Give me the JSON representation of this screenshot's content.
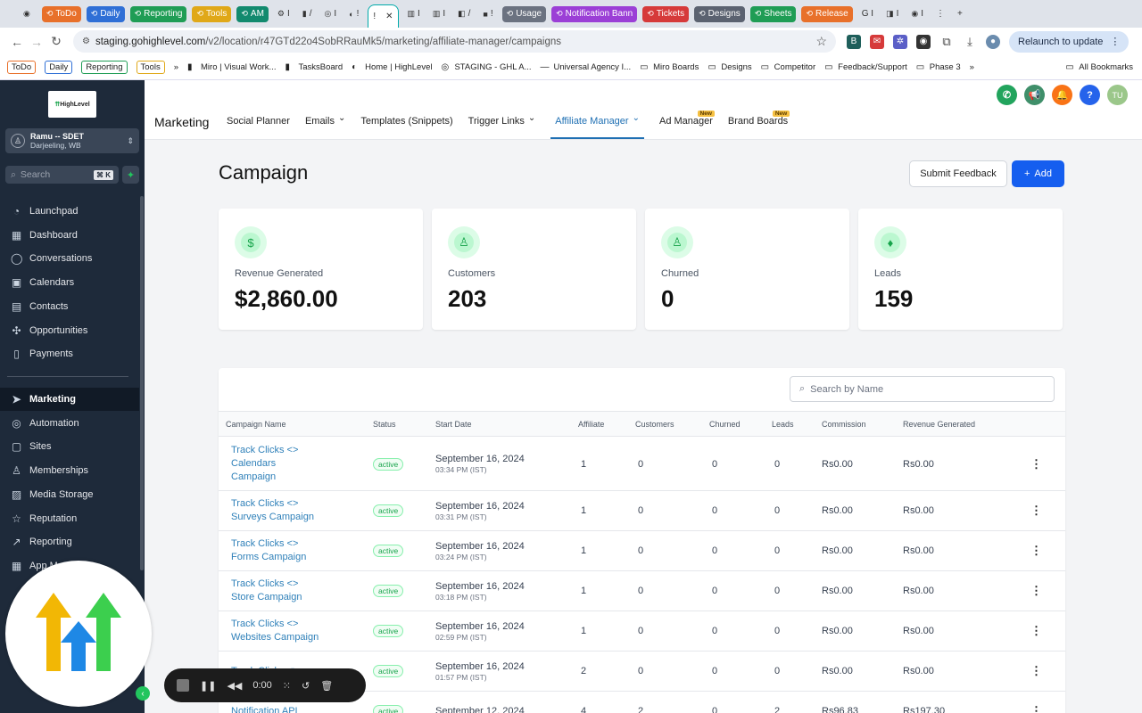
{
  "browser": {
    "tabs": [
      {
        "label": "",
        "color": "",
        "icon": "◉",
        "plain": true
      },
      {
        "label": "ToDo",
        "color": "#e8702a",
        "icon": "⟲"
      },
      {
        "label": "Daily",
        "color": "#2f6fd6",
        "icon": "⟲"
      },
      {
        "label": "Reporting",
        "color": "#1f9d55",
        "icon": "⟲"
      },
      {
        "label": "Tools",
        "color": "#e0a818",
        "icon": "⟲"
      },
      {
        "label": "AM",
        "color": "#128a6e",
        "icon": "⟲"
      },
      {
        "label": "I",
        "color": "",
        "icon": "⚙",
        "plain": true
      },
      {
        "label": "/",
        "color": "",
        "icon": "▮",
        "plain": true
      },
      {
        "label": "I",
        "color": "",
        "icon": "◎",
        "plain": true
      },
      {
        "label": "!",
        "color": "",
        "icon": "◐",
        "plain": true
      },
      {
        "label": "!",
        "color": "",
        "icon": "",
        "active": true
      },
      {
        "label": "I",
        "color": "",
        "icon": "▥",
        "plain": true
      },
      {
        "label": "I",
        "color": "",
        "icon": "▥",
        "plain": true
      },
      {
        "label": "/",
        "color": "",
        "icon": "◧",
        "plain": true
      },
      {
        "label": "!",
        "color": "",
        "icon": "■",
        "plain": true
      },
      {
        "label": "Usage",
        "color": "#6b7280",
        "icon": "⟲"
      },
      {
        "label": "Notification Bann",
        "color": "#9b3fd6",
        "icon": "⟲"
      },
      {
        "label": "Tickets",
        "color": "#d63a3a",
        "icon": "⟲"
      },
      {
        "label": "Designs",
        "color": "#5b6270",
        "icon": "⟲"
      },
      {
        "label": "Sheets",
        "color": "#1f9d55",
        "icon": "⟲"
      },
      {
        "label": "Release",
        "color": "#e8702a",
        "icon": "⟲"
      },
      {
        "label": "G I",
        "color": "",
        "icon": "",
        "plain": true
      },
      {
        "label": "I",
        "color": "",
        "icon": "◨",
        "plain": true
      },
      {
        "label": "I",
        "color": "",
        "icon": "◉",
        "plain": true
      },
      {
        "label": "⋮",
        "color": "",
        "icon": "",
        "plain": true
      },
      {
        "label": "+",
        "color": "",
        "icon": "",
        "plain": true
      }
    ],
    "url_host": "staging.gohighlevel.com",
    "url_path": "/v2/location/r47GTd22o4SobRRauMk5/marketing/affiliate-manager/campaigns",
    "relaunch_label": "Relaunch to update",
    "bookmarks": [
      {
        "label": "ToDo",
        "chip": true,
        "color": "#e8702a"
      },
      {
        "label": "Daily",
        "chip": true,
        "color": "#2f6fd6"
      },
      {
        "label": "Reporting",
        "chip": true,
        "color": "#1f9d55"
      },
      {
        "label": "Tools",
        "chip": true,
        "color": "#e0a818"
      },
      {
        "label": "»",
        "chip": false,
        "icon": ""
      },
      {
        "label": "Miro | Visual Work...",
        "chip": false,
        "icon": "▮"
      },
      {
        "label": "TasksBoard",
        "chip": false,
        "icon": "▮"
      },
      {
        "label": "Home | HighLevel",
        "chip": false,
        "icon": "◐"
      },
      {
        "label": "STAGING - GHL A...",
        "chip": false,
        "icon": "◎"
      },
      {
        "label": "Universal Agency I...",
        "chip": false,
        "icon": "—"
      },
      {
        "label": "Miro Boards",
        "chip": false,
        "icon": "▭"
      },
      {
        "label": "Designs",
        "chip": false,
        "icon": "▭"
      },
      {
        "label": "Competitor",
        "chip": false,
        "icon": "▭"
      },
      {
        "label": "Feedback/Support",
        "chip": false,
        "icon": "▭"
      },
      {
        "label": "Phase 3",
        "chip": false,
        "icon": "▭"
      },
      {
        "label": "»",
        "chip": false,
        "icon": ""
      },
      {
        "label": "All Bookmarks",
        "chip": false,
        "icon": "▭"
      }
    ]
  },
  "sidebar": {
    "logo_text": "HighLevel",
    "account_name": "Ramu -- SDET",
    "account_location": "Darjeeling, WB",
    "search_placeholder": "Search",
    "search_shortcut": "⌘ K",
    "items": [
      {
        "label": "Launchpad",
        "icon": "◔",
        "name": "launchpad"
      },
      {
        "label": "Dashboard",
        "icon": "▦",
        "name": "dashboard"
      },
      {
        "label": "Conversations",
        "icon": "◯",
        "name": "conversations"
      },
      {
        "label": "Calendars",
        "icon": "▣",
        "name": "calendars"
      },
      {
        "label": "Contacts",
        "icon": "▤",
        "name": "contacts"
      },
      {
        "label": "Opportunities",
        "icon": "✣",
        "name": "opportunities"
      },
      {
        "label": "Payments",
        "icon": "▯",
        "name": "payments"
      }
    ],
    "items2": [
      {
        "label": "Marketing",
        "icon": "➤",
        "name": "marketing",
        "active": true
      },
      {
        "label": "Automation",
        "icon": "◎",
        "name": "automation"
      },
      {
        "label": "Sites",
        "icon": "▢",
        "name": "sites"
      },
      {
        "label": "Memberships",
        "icon": "♙",
        "name": "memberships"
      },
      {
        "label": "Media Storage",
        "icon": "▨",
        "name": "media-storage"
      },
      {
        "label": "Reputation",
        "icon": "☆",
        "name": "reputation"
      },
      {
        "label": "Reporting",
        "icon": "↗",
        "name": "reporting"
      },
      {
        "label": "App M",
        "icon": "▦",
        "name": "app-marketplace"
      }
    ]
  },
  "header": {
    "title": "Marketing",
    "nav": [
      {
        "label": "Social Planner",
        "name": "social-planner"
      },
      {
        "label": "Emails",
        "name": "emails",
        "chevron": true
      },
      {
        "label": "Templates (Snippets)",
        "name": "templates"
      },
      {
        "label": "Trigger Links",
        "name": "trigger-links",
        "chevron": true
      },
      {
        "label": "Affiliate Manager",
        "name": "affiliate-manager",
        "chevron": true,
        "active": true
      },
      {
        "label": "Ad Manager",
        "name": "ad-manager",
        "badge": "New"
      },
      {
        "label": "Brand Boards",
        "name": "brand-boards",
        "badge": "New"
      }
    ],
    "avatar_initials": "TU"
  },
  "page": {
    "title": "Campaign",
    "feedback_label": "Submit Feedback",
    "add_label": "Add",
    "stats": [
      {
        "label": "Revenue Generated",
        "value": "$2,860.00",
        "icon": "$",
        "name": "revenue"
      },
      {
        "label": "Customers",
        "value": "203",
        "icon": "♙",
        "name": "customers"
      },
      {
        "label": "Churned",
        "value": "0",
        "icon": "♙",
        "name": "churned"
      },
      {
        "label": "Leads",
        "value": "159",
        "icon": "♦",
        "name": "leads"
      }
    ],
    "search_placeholder": "Search by Name",
    "columns": [
      "Campaign Name",
      "Status",
      "Start Date",
      "Affiliate",
      "Customers",
      "Churned",
      "Leads",
      "Commission",
      "Revenue Generated"
    ],
    "rows": [
      {
        "name": "Track Clicks <> Calendars Campaign",
        "status": "active",
        "date": "September 16, 2024",
        "time": "03:34 PM (IST)",
        "affiliate": "1",
        "customers": "0",
        "churned": "0",
        "leads": "0",
        "commission": "Rs0.00",
        "revenue": "Rs0.00"
      },
      {
        "name": "Track Clicks <> Surveys Campaign",
        "status": "active",
        "date": "September 16, 2024",
        "time": "03:31 PM (IST)",
        "affiliate": "1",
        "customers": "0",
        "churned": "0",
        "leads": "0",
        "commission": "Rs0.00",
        "revenue": "Rs0.00"
      },
      {
        "name": "Track Clicks <> Forms Campaign",
        "status": "active",
        "date": "September 16, 2024",
        "time": "03:24 PM (IST)",
        "affiliate": "1",
        "customers": "0",
        "churned": "0",
        "leads": "0",
        "commission": "Rs0.00",
        "revenue": "Rs0.00"
      },
      {
        "name": "Track Clicks <> Store Campaign",
        "status": "active",
        "date": "September 16, 2024",
        "time": "03:18 PM (IST)",
        "affiliate": "1",
        "customers": "0",
        "churned": "0",
        "leads": "0",
        "commission": "Rs0.00",
        "revenue": "Rs0.00"
      },
      {
        "name": "Track Clicks <> Websites Campaign",
        "status": "active",
        "date": "September 16, 2024",
        "time": "02:59 PM (IST)",
        "affiliate": "1",
        "customers": "0",
        "churned": "0",
        "leads": "0",
        "commission": "Rs0.00",
        "revenue": "Rs0.00"
      },
      {
        "name": "Track Clicks <>",
        "status": "active",
        "date": "September 16, 2024",
        "time": "01:57 PM (IST)",
        "affiliate": "2",
        "customers": "0",
        "churned": "0",
        "leads": "0",
        "commission": "Rs0.00",
        "revenue": "Rs0.00"
      },
      {
        "name": "Notification API",
        "status": "active",
        "date": "September 12, 2024",
        "time": "",
        "affiliate": "4",
        "customers": "2",
        "churned": "0",
        "leads": "2",
        "commission": "Rs96.83",
        "revenue": "Rs197.30"
      }
    ]
  },
  "recorder": {
    "time": "0:00"
  }
}
